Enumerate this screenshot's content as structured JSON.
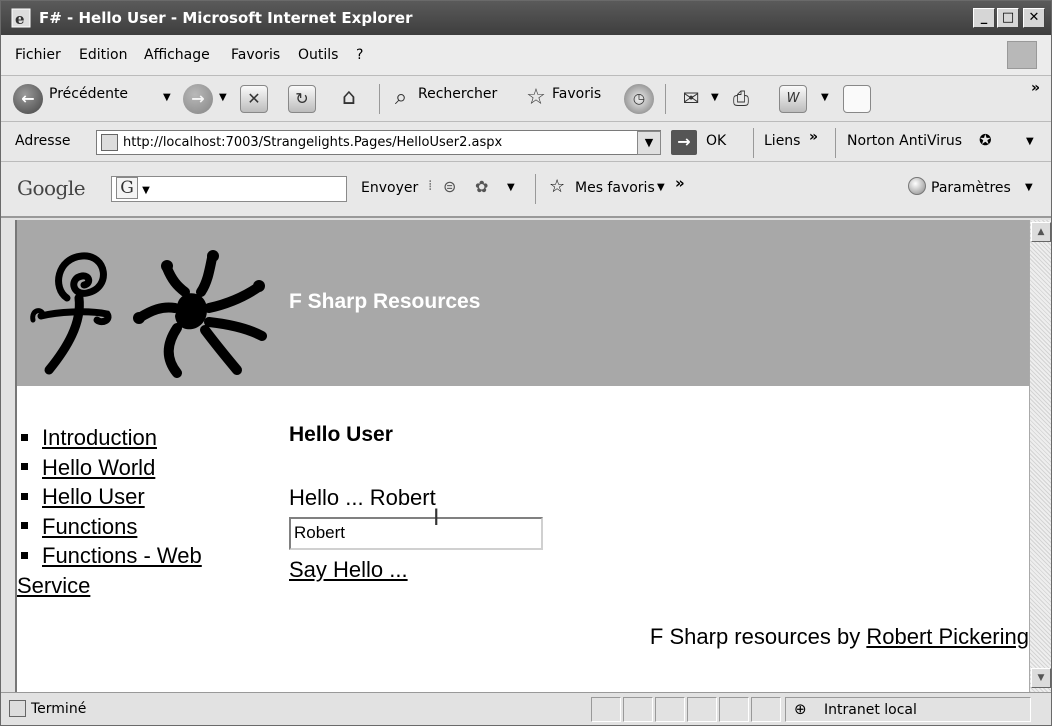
{
  "window": {
    "title": "F# - Hello User - Microsoft Internet Explorer",
    "minimize": "_",
    "maximize": "□",
    "close": "✕"
  },
  "menu": [
    "Fichier",
    "Edition",
    "Affichage",
    "Favoris",
    "Outils",
    "?"
  ],
  "toolbar": {
    "back_label": "Précédente",
    "search_label": "Rechercher",
    "favorites_label": "Favoris",
    "more": "»"
  },
  "address": {
    "label": "Adresse",
    "url": "http://localhost:7003/Strangelights.Pages/HelloUser2.aspx",
    "go_label": "OK",
    "links_label": "Liens",
    "links_more": "»",
    "norton_label": "Norton AntiVirus"
  },
  "google": {
    "logo": "Google",
    "input_logo": "G",
    "send_label": "Envoyer",
    "my_favorites": "Mes favoris",
    "more": "»",
    "settings": "Paramètres"
  },
  "page": {
    "site_title": "F Sharp Resources",
    "nav": [
      {
        "label": "Introduction"
      },
      {
        "label": "Hello World"
      },
      {
        "label": "Hello User"
      },
      {
        "label": "Functions"
      },
      {
        "label": "Functions - Web",
        "label2": "Service"
      }
    ],
    "heading": "Hello User",
    "greeting": "Hello ... Robert",
    "name_value": "Robert",
    "say_hello": "Say Hello ...",
    "footer_text": "F Sharp resources by ",
    "footer_link": "Robert Pickering"
  },
  "status": {
    "text": "Terminé",
    "zone": "Intranet local"
  }
}
